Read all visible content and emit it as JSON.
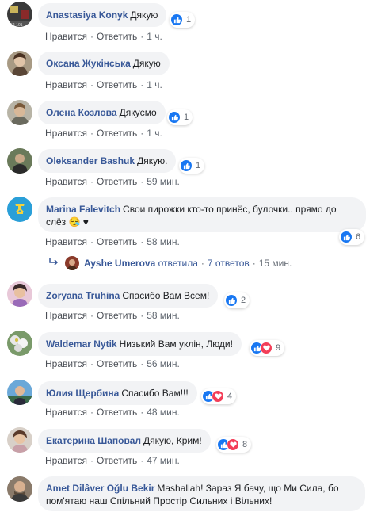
{
  "comments": [
    {
      "author": "Anastasiya Konyk",
      "text": "Дякую",
      "like_label": "Нравится",
      "reply_label": "Ответить",
      "time": "1 ч.",
      "reactions": {
        "count": "1",
        "types": [
          "like"
        ]
      }
    },
    {
      "author": "Оксана Жукінська",
      "text": "Дякую",
      "like_label": "Нравится",
      "reply_label": "Ответить",
      "time": "1 ч."
    },
    {
      "author": "Олена Козлова",
      "text": "Дякуємо",
      "like_label": "Нравится",
      "reply_label": "Ответить",
      "time": "1 ч.",
      "reactions": {
        "count": "1",
        "types": [
          "like"
        ]
      }
    },
    {
      "author": "Oleksander Bashuk",
      "text": "Дякую.",
      "like_label": "Нравится",
      "reply_label": "Ответить",
      "time": "59 мин.",
      "reactions": {
        "count": "1",
        "types": [
          "like"
        ]
      }
    },
    {
      "author": "Marina Falevitch",
      "text": "Свои пирожки кто-то принёс, булочки.. прямо до слёз",
      "emoji": "😪 ♥",
      "like_label": "Нравится",
      "reply_label": "Ответить",
      "time": "58 мин.",
      "reactions": {
        "count": "6",
        "types": [
          "like"
        ]
      }
    },
    {
      "author": "Zoryana Truhina",
      "text": "Спасибо Вам Всем!",
      "like_label": "Нравится",
      "reply_label": "Ответить",
      "time": "58 мин.",
      "reactions": {
        "count": "2",
        "types": [
          "like"
        ]
      }
    },
    {
      "author": "Waldemar Nytik",
      "text": "Низький Вам уклін, Люди!",
      "like_label": "Нравится",
      "reply_label": "Ответить",
      "time": "56 мин.",
      "reactions": {
        "count": "9",
        "types": [
          "like",
          "love"
        ]
      }
    },
    {
      "author": "Юлия Щербина",
      "text": "Спасибо Вам!!!",
      "like_label": "Нравится",
      "reply_label": "Ответить",
      "time": "48 мин.",
      "reactions": {
        "count": "4",
        "types": [
          "like",
          "love"
        ]
      }
    },
    {
      "author": "Екатерина Шаповал",
      "text": "Дякую, Крим!",
      "like_label": "Нравится",
      "reply_label": "Ответить",
      "time": "47 мин.",
      "reactions": {
        "count": "8",
        "types": [
          "like",
          "love"
        ]
      }
    },
    {
      "author": "Amet Dilâver Oğlu Bekir",
      "text": "Mashallah! Зараз Я бачу, що Ми Сила, бо пом'ятаю наш Спільний Простір Сильних і Вільних!"
    }
  ],
  "reply_summary": {
    "name": "Ayshe Umerova",
    "action": "ответила",
    "count": "7 ответов",
    "time": "15 мин."
  },
  "colors": {
    "author": "#385898",
    "bubble": "#f2f3f5",
    "like": "#1877f2",
    "love": "#f33e58",
    "meta": "#606770"
  },
  "avatar_badge": "52-101"
}
